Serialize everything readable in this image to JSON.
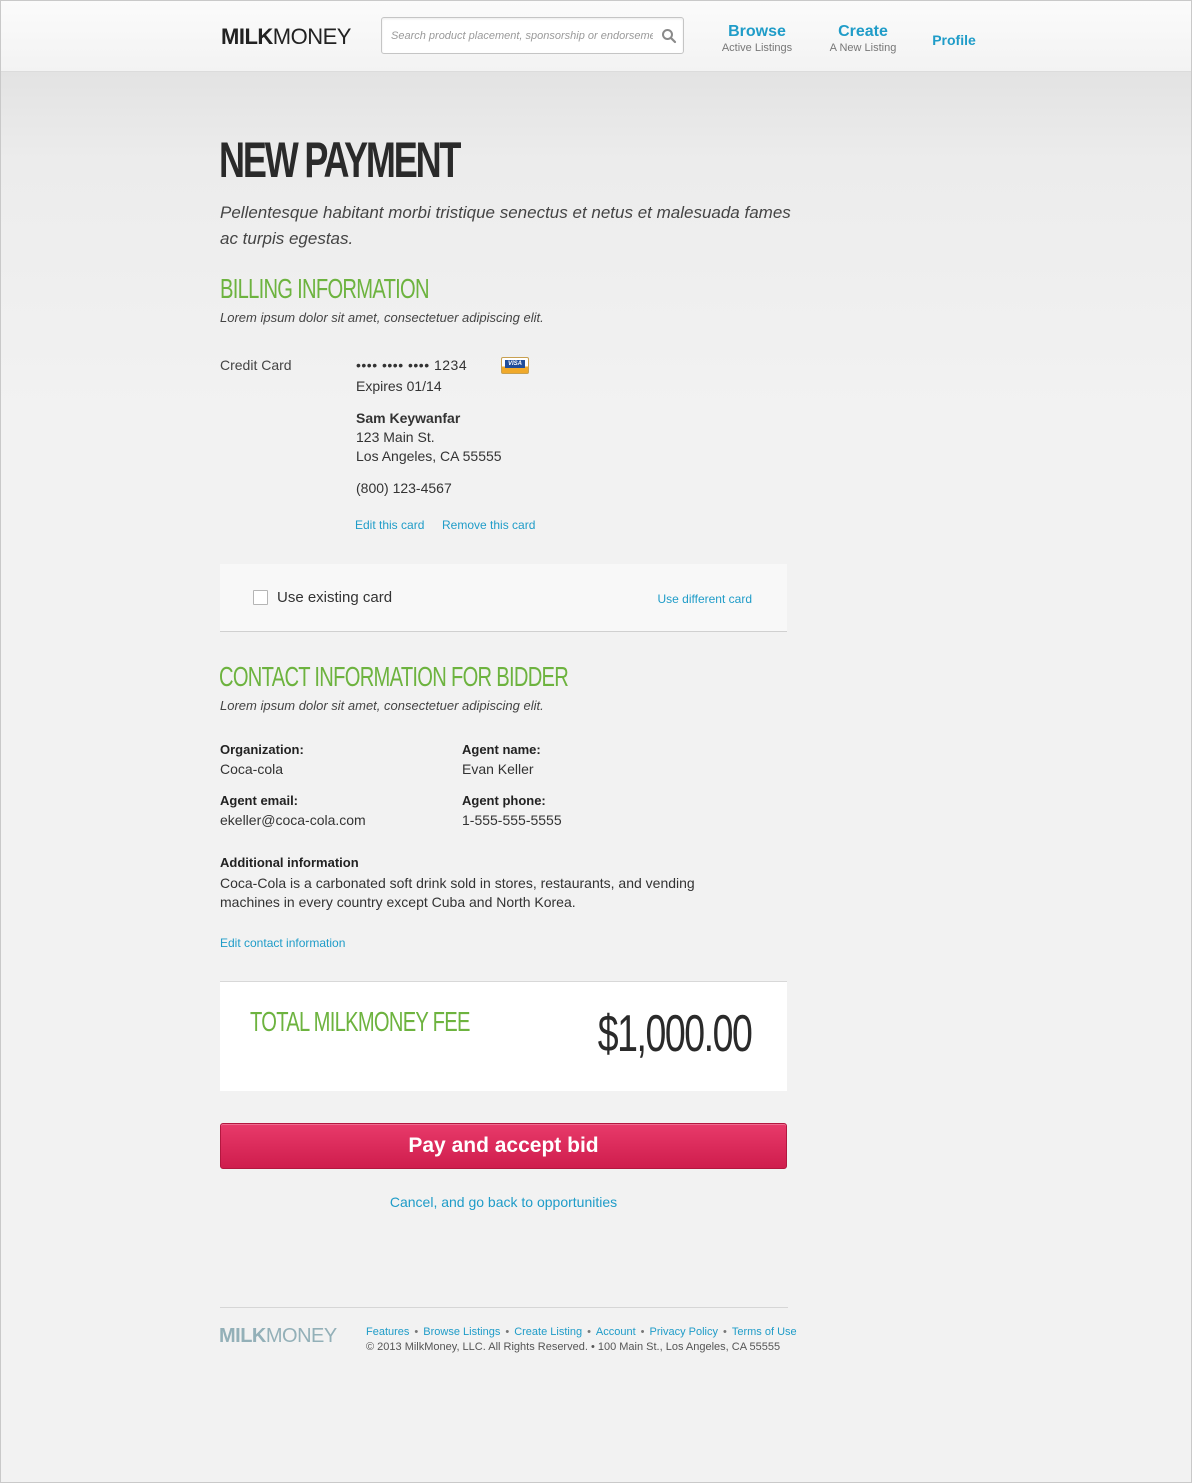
{
  "brand": {
    "bold": "MILK",
    "light": "MONEY"
  },
  "search": {
    "placeholder": "Search product placement, sponsorship or endorsements"
  },
  "nav": {
    "browse": {
      "label": "Browse",
      "sub": "Active Listings"
    },
    "create": {
      "label": "Create",
      "sub": "A New Listing"
    },
    "profile": {
      "label": "Profile"
    }
  },
  "page": {
    "title": "NEW PAYMENT",
    "intro": "Pellentesque habitant morbi tristique senectus et netus et malesuada fames ac turpis egestas."
  },
  "billing": {
    "title": "BILLING INFORMATION",
    "subtitle": "Lorem ipsum dolor sit amet, consectetuer adipiscing elit.",
    "card_label": "Credit Card",
    "card_number": "•••• •••• •••• 1234",
    "card_brand": "VISA",
    "expires": "Expires 01/14",
    "name": "Sam Keywanfar",
    "address1": "123 Main St.",
    "address2": "Los Angeles, CA 55555",
    "phone": "(800) 123-4567",
    "edit_link": "Edit this card",
    "remove_link": "Remove this card",
    "use_existing": "Use existing card",
    "use_existing_checked": false,
    "use_different": "Use different card"
  },
  "contact": {
    "title": "CONTACT INFORMATION FOR BIDDER",
    "subtitle": "Lorem ipsum dolor sit amet, consectetuer adipiscing elit.",
    "org_label": "Organization:",
    "org_value": "Coca-cola",
    "agent_name_label": "Agent name:",
    "agent_name_value": "Evan Keller",
    "agent_email_label": "Agent email:",
    "agent_email_value": "ekeller@coca-cola.com",
    "agent_phone_label": "Agent phone:",
    "agent_phone_value": "1-555-555-5555",
    "additional_label": "Additional information",
    "additional_value": "Coca-Cola is a carbonated soft drink sold in stores, restaurants, and vending machines in every country except Cuba and North Korea.",
    "edit_link": "Edit contact information"
  },
  "fee": {
    "label": "TOTAL MILKMONEY FEE",
    "amount": "$1,000.00"
  },
  "actions": {
    "pay": "Pay and accept bid",
    "cancel": "Cancel, and go back to opportunities"
  },
  "footer": {
    "links": [
      "Features",
      "Browse Listings",
      "Create Listing",
      "Account",
      "Privacy Policy",
      "Terms of Use"
    ],
    "copyright": "© 2013 MilkMoney, LLC. All Rights Reserved.  •  100 Main St., Los Angeles, CA 55555"
  },
  "colors": {
    "accent": "#1f9cc8",
    "section_green": "#6db33f",
    "button_pink": "#d9245a"
  }
}
